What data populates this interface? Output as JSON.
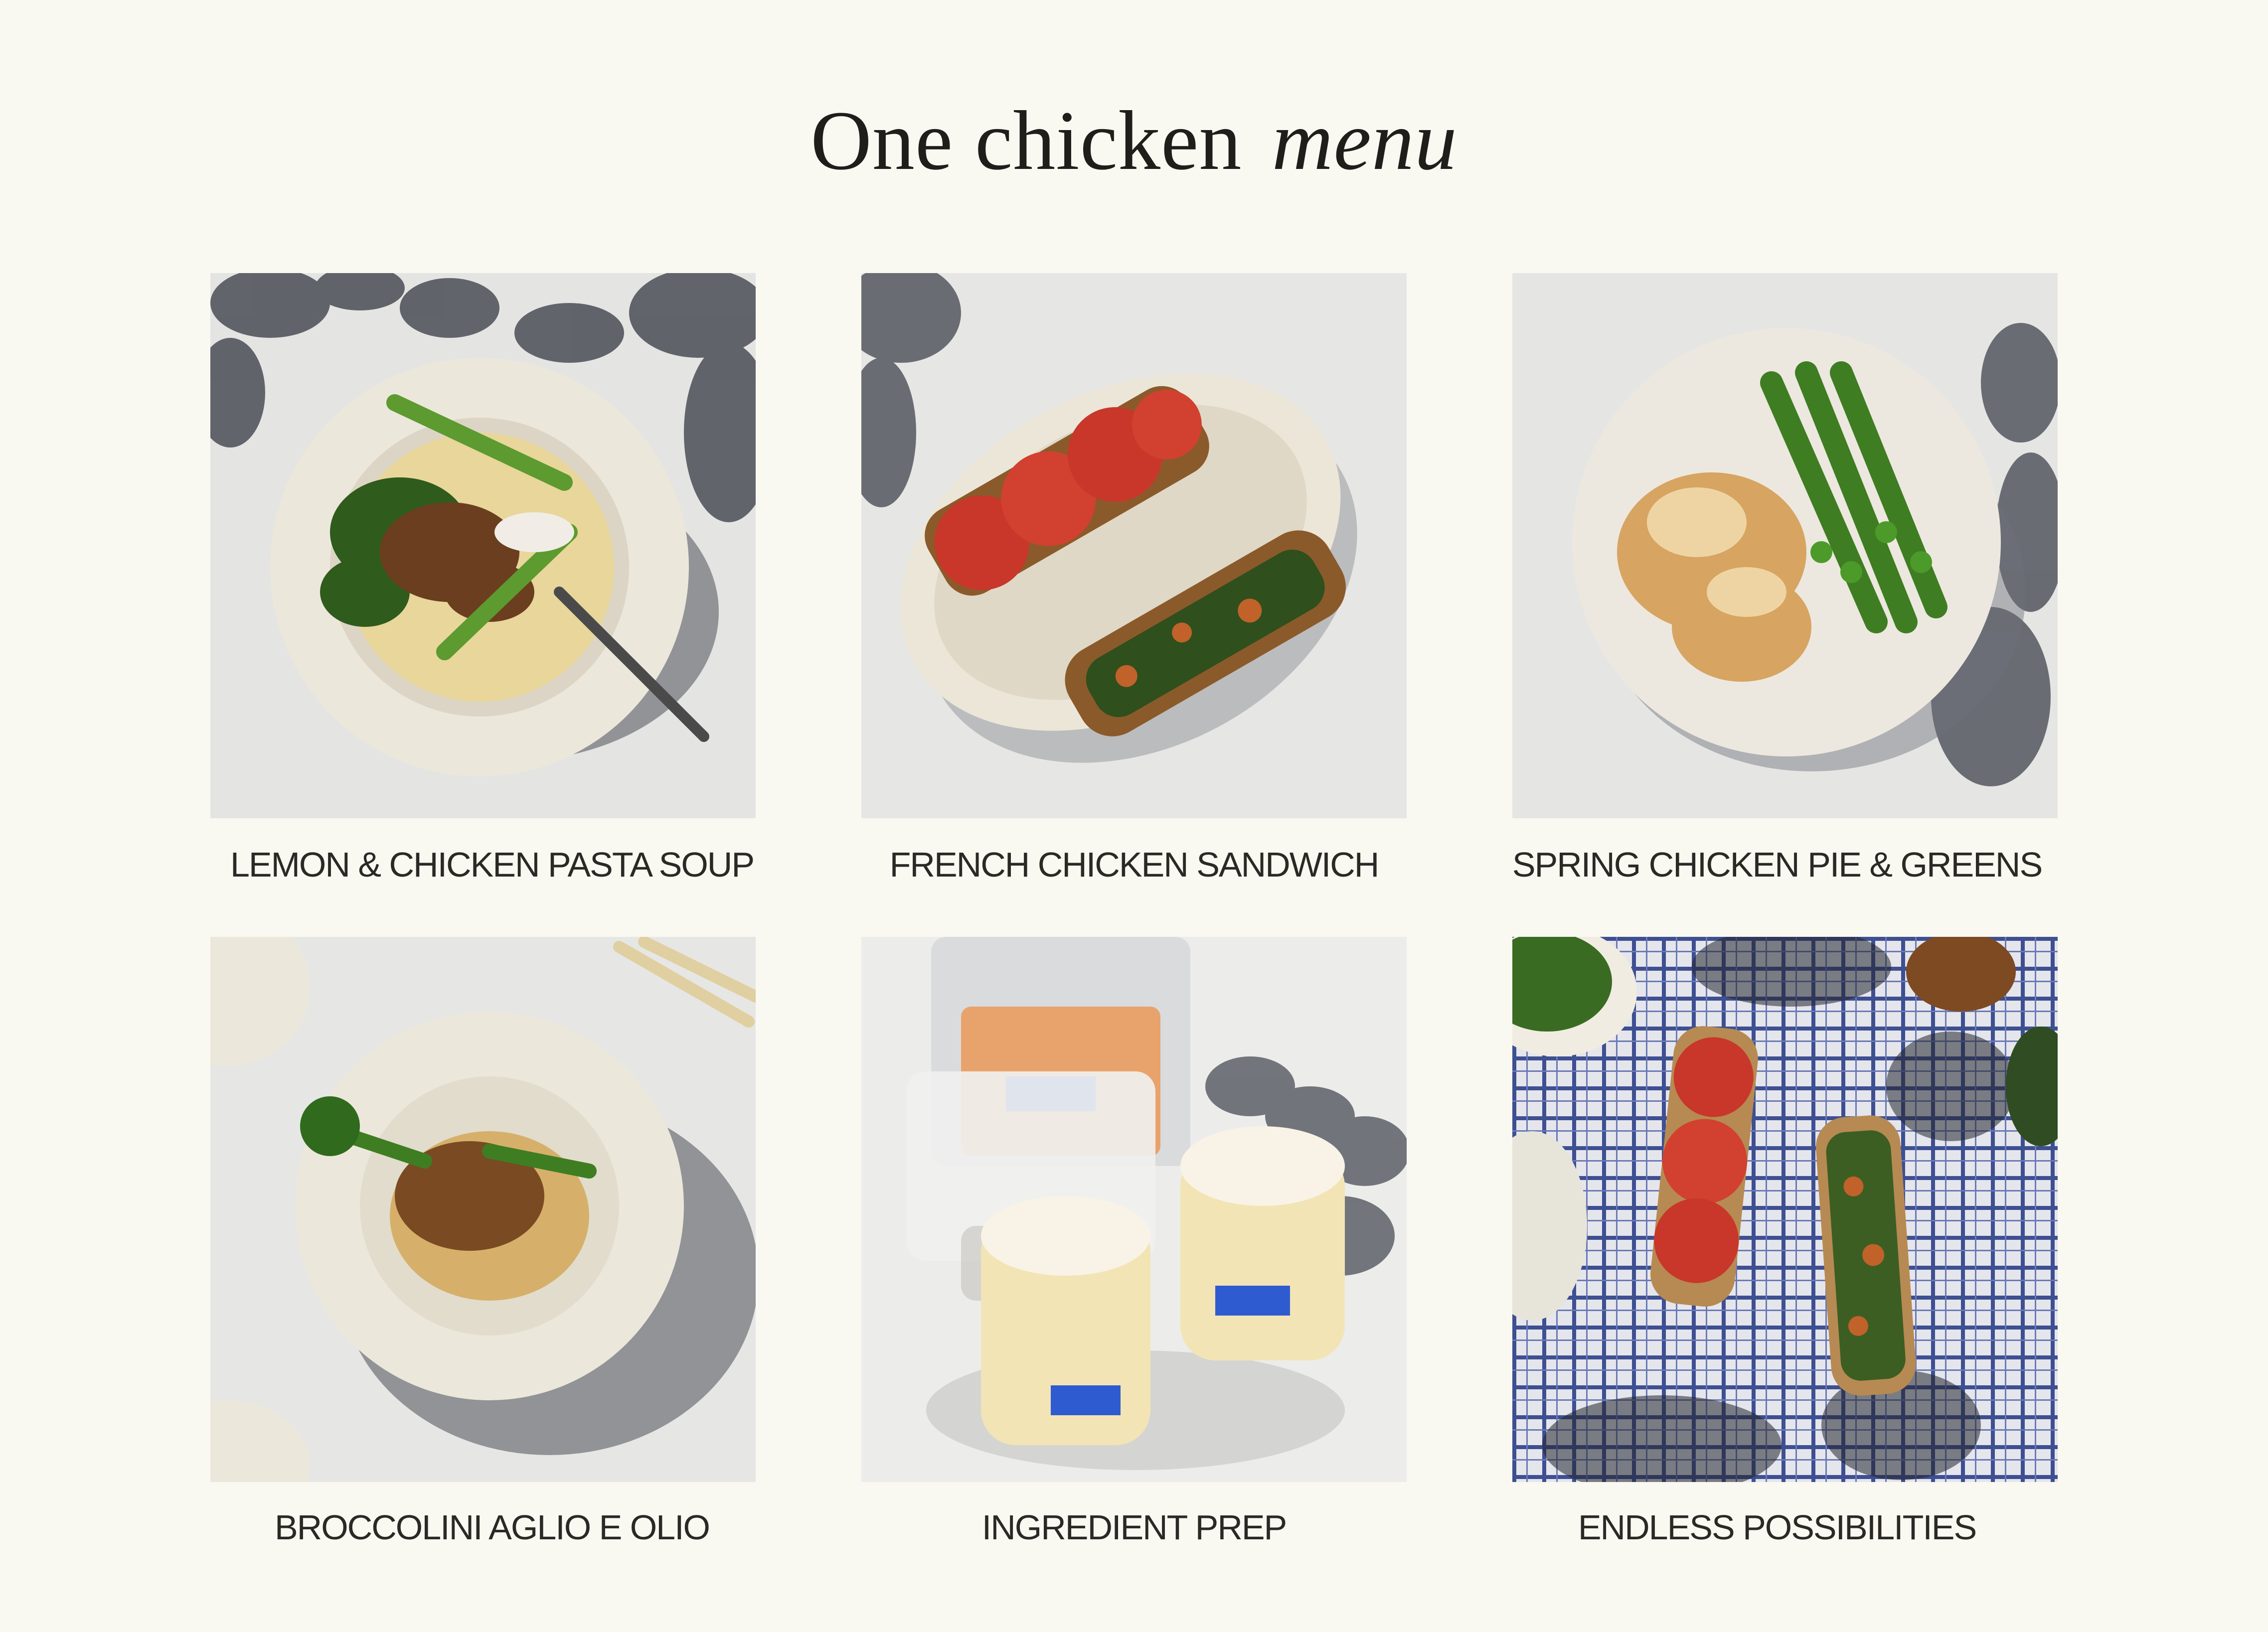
{
  "page": {
    "title_lead": "One chicken",
    "title_accent": "menu"
  },
  "menu": {
    "items": [
      {
        "caption": "LEMON & CHICKEN PASTA SOUP",
        "image": "pasta-soup-photo"
      },
      {
        "caption": "FRENCH CHICKEN SANDWICH",
        "image": "chicken-sandwich-photo"
      },
      {
        "caption": "SPRING CHICKEN PIE & GREENS",
        "image": "chicken-pie-photo"
      },
      {
        "caption": "BROCCOLINI AGLIO E OLIO",
        "image": "broccolini-pasta-photo"
      },
      {
        "caption": "INGREDIENT PREP",
        "image": "ingredient-prep-photo"
      },
      {
        "caption": "ENDLESS POSSIBILITIES",
        "image": "picnic-table-photo"
      }
    ]
  },
  "colors": {
    "background": "#f9f8f1",
    "text": "#1c1c1a",
    "tablecloth": "#e7e7e4",
    "plate": "#ece7db",
    "tomato": "#c8372a",
    "asparagus": "#3f7d22",
    "shadow": "#3b3e48",
    "check_blue": "#3e4f92"
  }
}
